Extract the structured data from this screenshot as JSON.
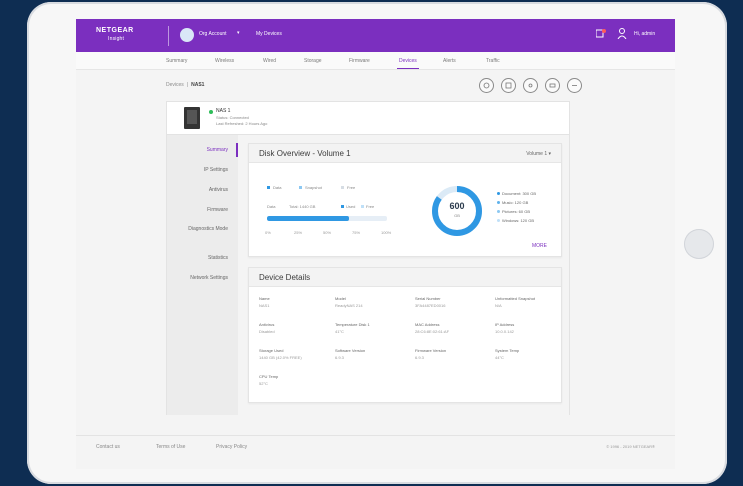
{
  "topbar": {
    "logo_main": "NETGEAR",
    "logo_sub": "Insight",
    "org_name": "Org Account",
    "org_caret": "▾",
    "my_devices": "My Devices",
    "user_name": "Hi, admin"
  },
  "subnav": {
    "tabs": [
      "Summary",
      "Wireless",
      "Wired",
      "Storage",
      "Firmware",
      "Devices",
      "Alerts",
      "Traffic"
    ],
    "active_tab": "Devices"
  },
  "breadcrumb": {
    "parent": "Devices",
    "separator": "|",
    "current": "NAS1"
  },
  "device": {
    "name": "NAS 1",
    "status": "Status: Connected",
    "last_refreshed": "Last Refreshed: 2 Hours Ago",
    "status_color": "#2ebd59"
  },
  "sidebar": {
    "items": [
      "Summary",
      "IP Settings",
      "Antivirus",
      "Firmware",
      "Diagnostics Mode",
      "Statistics",
      "Network Settings"
    ],
    "active": "Summary"
  },
  "disk_overview": {
    "title": "Disk Overview - Volume 1",
    "volume_select": "Volume 1 ▾",
    "legend": [
      "Data",
      "Snapshot",
      "Free"
    ],
    "bar_label_used": "Data",
    "bar_label_total": "Total: 1440 GB",
    "bar_legend": [
      "Used",
      "Free"
    ],
    "used_fraction": 0.68,
    "ticks": [
      "0%",
      "25%",
      "50%",
      "75%",
      "100%"
    ],
    "donut_value": "600",
    "donut_unit": "GB",
    "donut_fraction": 0.85,
    "donut_legend": [
      "Document: 300 GB",
      "Music: 120 GB",
      "Pictures: 60 GB",
      "Windows: 120 GB"
    ],
    "donut_colors": [
      "#2f98e3",
      "#5fb2ec",
      "#8cc8f2",
      "#bfe0f8"
    ],
    "more_link": "MORE",
    "accent": "#2f98e3"
  },
  "device_details": {
    "title": "Device Details",
    "fields": [
      {
        "label": "Name",
        "value": "NAS1"
      },
      {
        "label": "Model",
        "value": "ReadyNAS 214"
      },
      {
        "label": "Serial Number",
        "value": "3FA4487ED0016"
      },
      {
        "label": "Unformatted Snapshot",
        "value": "N/A"
      },
      {
        "label": "Antivirus",
        "value": "Disabled"
      },
      {
        "label": "Temperature Disk 1",
        "value": "41°C"
      },
      {
        "label": "MAC Address",
        "value": "28:C6:8E:02:61:AF"
      },
      {
        "label": "IP Address",
        "value": "10.0.0.142"
      },
      {
        "label": "Storage Used",
        "value": "1440 GB (42.0% FREE)"
      },
      {
        "label": "Software Version",
        "value": "6.9.3"
      },
      {
        "label": "Firmware Version",
        "value": "6.9.3"
      },
      {
        "label": "System Temp",
        "value": "44°C"
      },
      {
        "label": "CPU Temp",
        "value": "52°C"
      }
    ]
  },
  "footer": {
    "links": [
      "Contact us",
      "Terms of Use",
      "Privacy Policy"
    ],
    "copyright": "© 1996 - 2019 NETGEAR®"
  },
  "colors": {
    "brand": "#7b2fbf",
    "background": "#0e2d52"
  }
}
